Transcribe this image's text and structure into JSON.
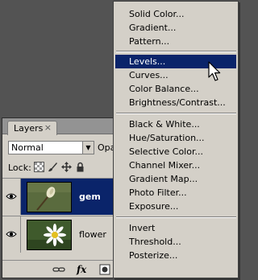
{
  "layers_panel": {
    "tab_label": "Layers",
    "tab_close": "×",
    "blend_mode": "Normal",
    "opacity_label": "Opac",
    "lock_label": "Lock:",
    "layers": [
      {
        "name": "gem",
        "selected": true,
        "visible": true
      },
      {
        "name": "flower",
        "selected": false,
        "visible": true
      }
    ],
    "footer_icons": [
      "link-icon",
      "fx-icon",
      "mask-icon",
      "adjustment-layer-icon",
      "group-icon",
      "new-layer-icon",
      "trash-icon"
    ],
    "footer_fx_label": "fx"
  },
  "menu": {
    "groups": [
      [
        "Solid Color...",
        "Gradient...",
        "Pattern..."
      ],
      [
        "Levels...",
        "Curves...",
        "Color Balance...",
        "Brightness/Contrast..."
      ],
      [
        "Black & White...",
        "Hue/Saturation...",
        "Selective Color...",
        "Channel Mixer...",
        "Gradient Map...",
        "Photo Filter...",
        "Exposure..."
      ],
      [
        "Invert",
        "Threshold...",
        "Posterize..."
      ]
    ],
    "highlighted_item": "Levels..."
  },
  "colors": {
    "background": "#535353",
    "panel": "#d4d0c8",
    "selection": "#0a246a"
  }
}
